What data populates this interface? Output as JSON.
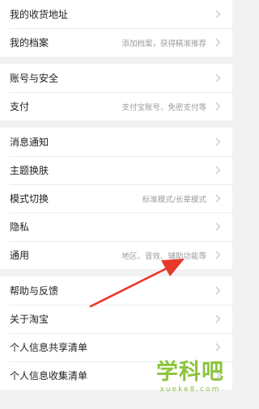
{
  "colors": {
    "background": "#f2f2f2",
    "row_background": "#ffffff",
    "text": "#222222",
    "hint": "#9b9b9b",
    "chevron": "#c0c0c0",
    "annotation_arrow": "#e8382a",
    "watermark": "#8cc43c"
  },
  "icons": {
    "row_chevron": "chevron-right-icon",
    "annotation": "red-pointer-arrow-icon"
  },
  "groups": [
    {
      "items": [
        {
          "label": "我的收货地址",
          "hint": ""
        },
        {
          "label": "我的档案",
          "hint": "添加档案，获得精准推荐"
        }
      ]
    },
    {
      "items": [
        {
          "label": "账号与安全",
          "hint": ""
        },
        {
          "label": "支付",
          "hint": "支付宝账号、免密支付等"
        }
      ]
    },
    {
      "items": [
        {
          "label": "消息通知",
          "hint": ""
        },
        {
          "label": "主题换肤",
          "hint": ""
        },
        {
          "label": "模式切换",
          "hint": "标准模式/长辈模式"
        },
        {
          "label": "隐私",
          "hint": ""
        },
        {
          "label": "通用",
          "hint": "地区、音效、辅助功能等"
        }
      ]
    },
    {
      "items": [
        {
          "label": "帮助与反馈",
          "hint": ""
        },
        {
          "label": "关于淘宝",
          "hint": ""
        },
        {
          "label": "个人信息共享清单",
          "hint": ""
        },
        {
          "label": "个人信息收集清单",
          "hint": ""
        }
      ]
    }
  ],
  "watermark": {
    "title": "学科吧",
    "url": "xueke8.com"
  }
}
